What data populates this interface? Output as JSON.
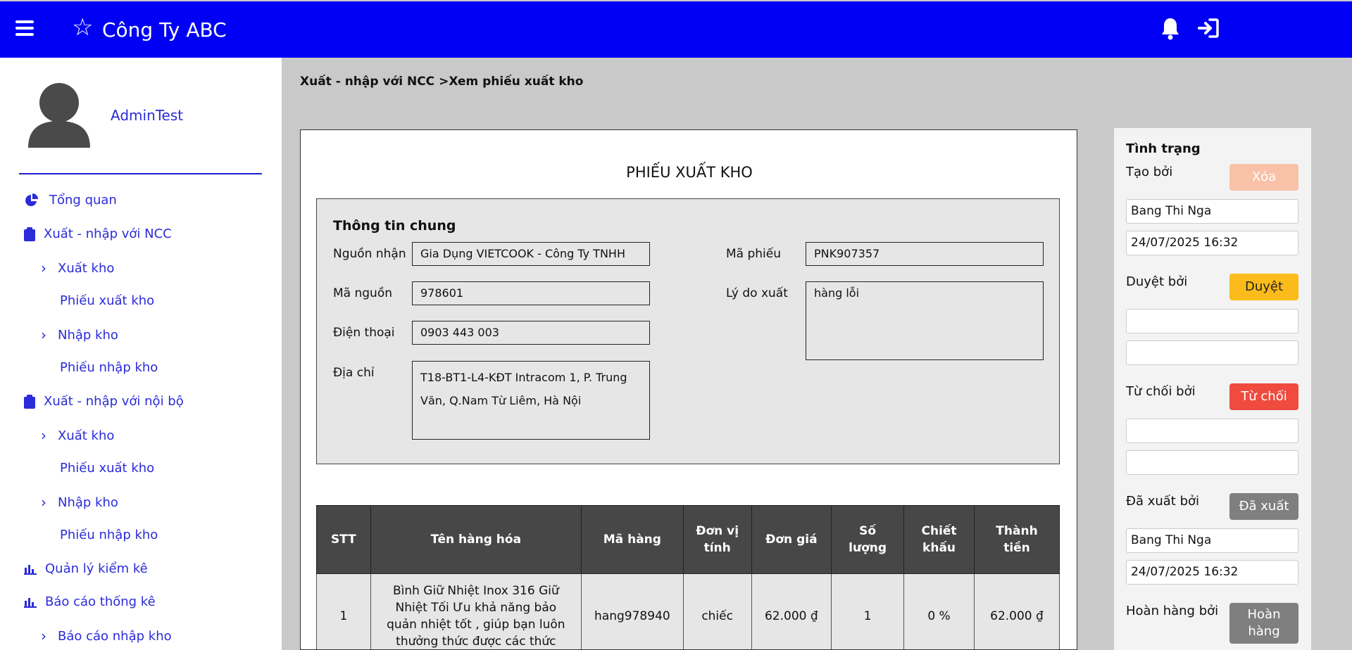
{
  "header": {
    "company": "Công Ty ABC"
  },
  "sidebar": {
    "user": "AdminTest",
    "items": [
      {
        "label": "Tổng quan",
        "icon": "pie-chart-icon"
      },
      {
        "label": "Xuất - nhập với NCC",
        "icon": "clipboard-icon"
      },
      {
        "label": "Xuất kho",
        "icon": "chevron-right-icon"
      },
      {
        "label": "Phiếu xuất kho"
      },
      {
        "label": "Nhập kho",
        "icon": "chevron-right-icon"
      },
      {
        "label": "Phiếu nhập kho"
      },
      {
        "label": "Xuất - nhập với nội bộ",
        "icon": "clipboard-icon"
      },
      {
        "label": "Xuất kho",
        "icon": "chevron-right-icon"
      },
      {
        "label": "Phiếu xuất kho"
      },
      {
        "label": "Nhập kho",
        "icon": "chevron-right-icon"
      },
      {
        "label": "Phiếu nhập kho"
      },
      {
        "label": "Quản lý kiểm kê",
        "icon": "bar-chart-icon"
      },
      {
        "label": "Báo cáo thống kê",
        "icon": "bar-chart-icon"
      },
      {
        "label": "Báo cáo nhập kho",
        "icon": "chevron-right-icon"
      }
    ]
  },
  "breadcrumb": "Xuất - nhập với NCC >Xem phiếu xuất kho",
  "sheet": {
    "title": "PHIẾU XUẤT KHO",
    "info_heading": "Thông tin chung",
    "labels": {
      "source": "Nguồn nhận",
      "source_code": "Mã nguồn",
      "phone": "Điện thoại",
      "address": "Địa chỉ",
      "slip_code": "Mã phiếu",
      "reason": "Lý do xuất"
    },
    "values": {
      "source": "Gia Dụng VIETCOOK - Công Ty TNHH",
      "source_code": "978601",
      "phone": "0903 443 003",
      "address": "T18-BT1-L4-KĐT Intracom 1, P. Trung Văn, Q.Nam Từ Liêm, Hà Nội",
      "slip_code": "PNK907357",
      "reason": "hàng lỗi"
    },
    "table": {
      "headers": [
        "STT",
        "Tên hàng hóa",
        "Mã hàng",
        "Đơn vị tính",
        "Đơn giá",
        "Số lượng",
        "Chiết khấu",
        "Thành tiền"
      ],
      "rows": [
        [
          "1",
          "Bình Giữ Nhiệt Inox 316 Giữ Nhiệt Tối Ưu khả năng bảo quản nhiệt tốt , giúp bạn luôn thưởng thức được các thức",
          "hang978940",
          "chiếc",
          "62.000 ₫",
          "1",
          "0 %",
          "62.000 ₫"
        ]
      ]
    }
  },
  "panel": {
    "title": "Tình trạng",
    "created_label": "Tạo bởi",
    "delete_btn": "Xóa",
    "created_by": "Bang Thi Nga",
    "created_at": "24/07/2025 16:32",
    "approved_label": "Duyệt bởi",
    "approve_btn": "Duyệt",
    "approved_by": "",
    "approved_at": "",
    "rejected_label": "Từ chối bởi",
    "reject_btn": "Từ chối",
    "rejected_by": "",
    "rejected_at": "",
    "exported_label": "Đã xuất bởi",
    "export_btn": "Đã xuất",
    "exported_by": "Bang Thi Nga",
    "exported_at": "24/07/2025 16:32",
    "returned_label": "Hoàn hàng bởi",
    "return_btn": "Hoàn hàng",
    "colors": {
      "delete": "#f9c1a8",
      "approve": "#fbbc1b",
      "reject": "#ef4b3f",
      "export": "#7f7f7f",
      "return": "#7f7f7f"
    }
  },
  "colors": {
    "topbar": "#0000f5",
    "sidebar_link": "#2b2bd9"
  }
}
